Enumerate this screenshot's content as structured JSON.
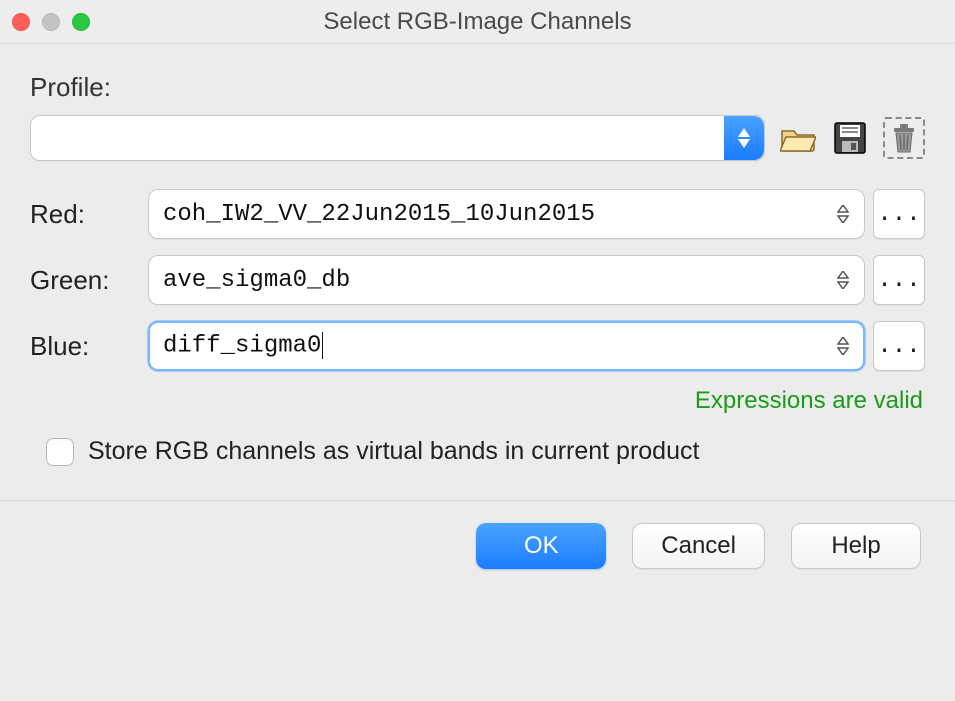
{
  "window": {
    "title": "Select RGB-Image Channels"
  },
  "profile": {
    "label": "Profile:",
    "value": ""
  },
  "channels": {
    "red": {
      "label": "Red:",
      "value": "coh_IW2_VV_22Jun2015_10Jun2015",
      "ellipsis": "...",
      "focused": false
    },
    "green": {
      "label": "Green:",
      "value": "ave_sigma0_db",
      "ellipsis": "...",
      "focused": false
    },
    "blue": {
      "label": "Blue:",
      "value": "diff_sigma0",
      "ellipsis": "...",
      "focused": true
    }
  },
  "validation_message": "Expressions are valid",
  "store_checkbox": {
    "label": "Store RGB channels as virtual bands in current product",
    "checked": false
  },
  "buttons": {
    "ok": "OK",
    "cancel": "Cancel",
    "help": "Help"
  },
  "icons": {
    "open": "open-folder-icon",
    "save": "floppy-save-icon",
    "delete": "trash-icon"
  }
}
